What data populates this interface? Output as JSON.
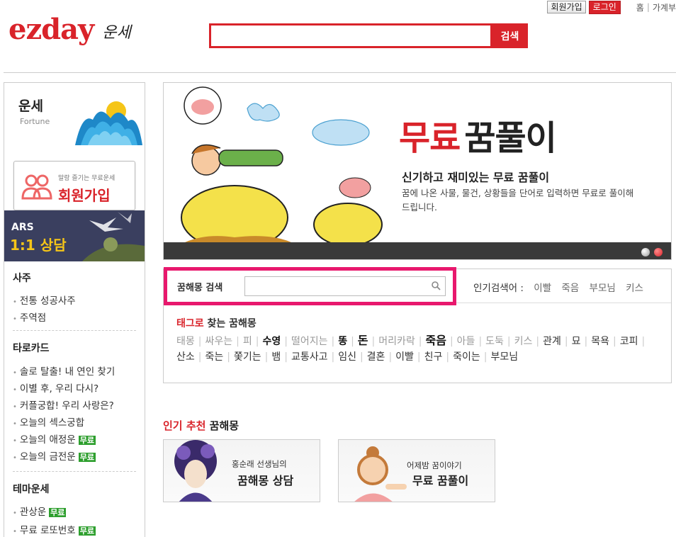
{
  "topbar": {
    "join_label": "회원가입",
    "login_label": "로그인",
    "home_label": "홈",
    "family_label": "가계부"
  },
  "header": {
    "logo": "ezday",
    "logo_sub": "운세",
    "search_button": "검색",
    "search_value": ""
  },
  "sidebar": {
    "title": "운세",
    "subtitle": "Fortune",
    "join_promo_small": "말랑 즐기는 무료운세",
    "join_promo_big": "회원가입",
    "ars_line1": "ARS",
    "ars_line2": "1:1 상담",
    "sections": [
      {
        "title": "사주",
        "items": [
          {
            "label": "전통 성공사주"
          },
          {
            "label": "주역점"
          }
        ]
      },
      {
        "title": "타로카드",
        "items": [
          {
            "label": "솔로 탈출! 내 연인 찾기"
          },
          {
            "label": "이별 후, 우리 다시?"
          },
          {
            "label": "커플궁합! 우리 사랑은?"
          },
          {
            "label": "오늘의 섹스궁합"
          },
          {
            "label": "오늘의 애정운",
            "badge": "무료"
          },
          {
            "label": "오늘의 금전운",
            "badge": "무료"
          }
        ]
      },
      {
        "title": "테마운세",
        "items": [
          {
            "label": "관상운",
            "badge": "무료"
          },
          {
            "label": "무료 로또번호",
            "badge": "무료"
          }
        ]
      }
    ]
  },
  "banner": {
    "title_red": "무료",
    "title_black": "꿈풀이",
    "subtitle": "신기하고 재미있는 무료 꿈풀이",
    "description": "꿈에 나온 사물, 물건, 상황들을 단어로 입력하면 무료로 풀이해 드립니다."
  },
  "dream_search": {
    "label": "꿈해몽 검색",
    "input_value": "",
    "popular_label": "인기검색어 :",
    "popular": [
      "이빨",
      "죽음",
      "부모님",
      "키스"
    ],
    "tag_title_red": "태그로",
    "tag_title_rest": " 찾는 꿈해몽",
    "tags": [
      {
        "text": "태몽",
        "s": 1
      },
      {
        "text": "싸우는",
        "s": 1
      },
      {
        "text": "피",
        "s": 1
      },
      {
        "text": "수영",
        "s": 3
      },
      {
        "text": "떨어지는",
        "s": 1
      },
      {
        "text": "똥",
        "s": 3
      },
      {
        "text": "돈",
        "s": 3,
        "big": true
      },
      {
        "text": "머리카락",
        "s": 1
      },
      {
        "text": "죽음",
        "s": 3,
        "big": true
      },
      {
        "text": "아들",
        "s": 1
      },
      {
        "text": "도둑",
        "s": 1
      },
      {
        "text": "키스",
        "s": 1
      },
      {
        "text": "관계",
        "s": 2
      },
      {
        "text": "묘",
        "s": 2
      },
      {
        "text": "목욕",
        "s": 2
      },
      {
        "text": "코피",
        "s": 2
      },
      {
        "text": "산소",
        "s": 2
      },
      {
        "text": "죽는",
        "s": 2
      },
      {
        "text": "쫓기는",
        "s": 2
      },
      {
        "text": "뱀",
        "s": 2
      },
      {
        "text": "교통사고",
        "s": 2
      },
      {
        "text": "임신",
        "s": 2
      },
      {
        "text": "결혼",
        "s": 2
      },
      {
        "text": "이빨",
        "s": 2
      },
      {
        "text": "친구",
        "s": 2
      },
      {
        "text": "죽이는",
        "s": 2
      },
      {
        "text": "부모님",
        "s": 2
      }
    ]
  },
  "recommend": {
    "title_red": "인기 추천",
    "title_rest": " 꿈해몽",
    "cards": [
      {
        "small": "홍순래 선생님의",
        "big": "꿈해몽 상담"
      },
      {
        "small": "어제밤 꿈이야기",
        "big": "무료 꿈풀이"
      }
    ]
  },
  "colors": {
    "brand_red": "#d9232a",
    "highlight_pink": "#e8186d",
    "badge_green": "#2e9f2e"
  }
}
